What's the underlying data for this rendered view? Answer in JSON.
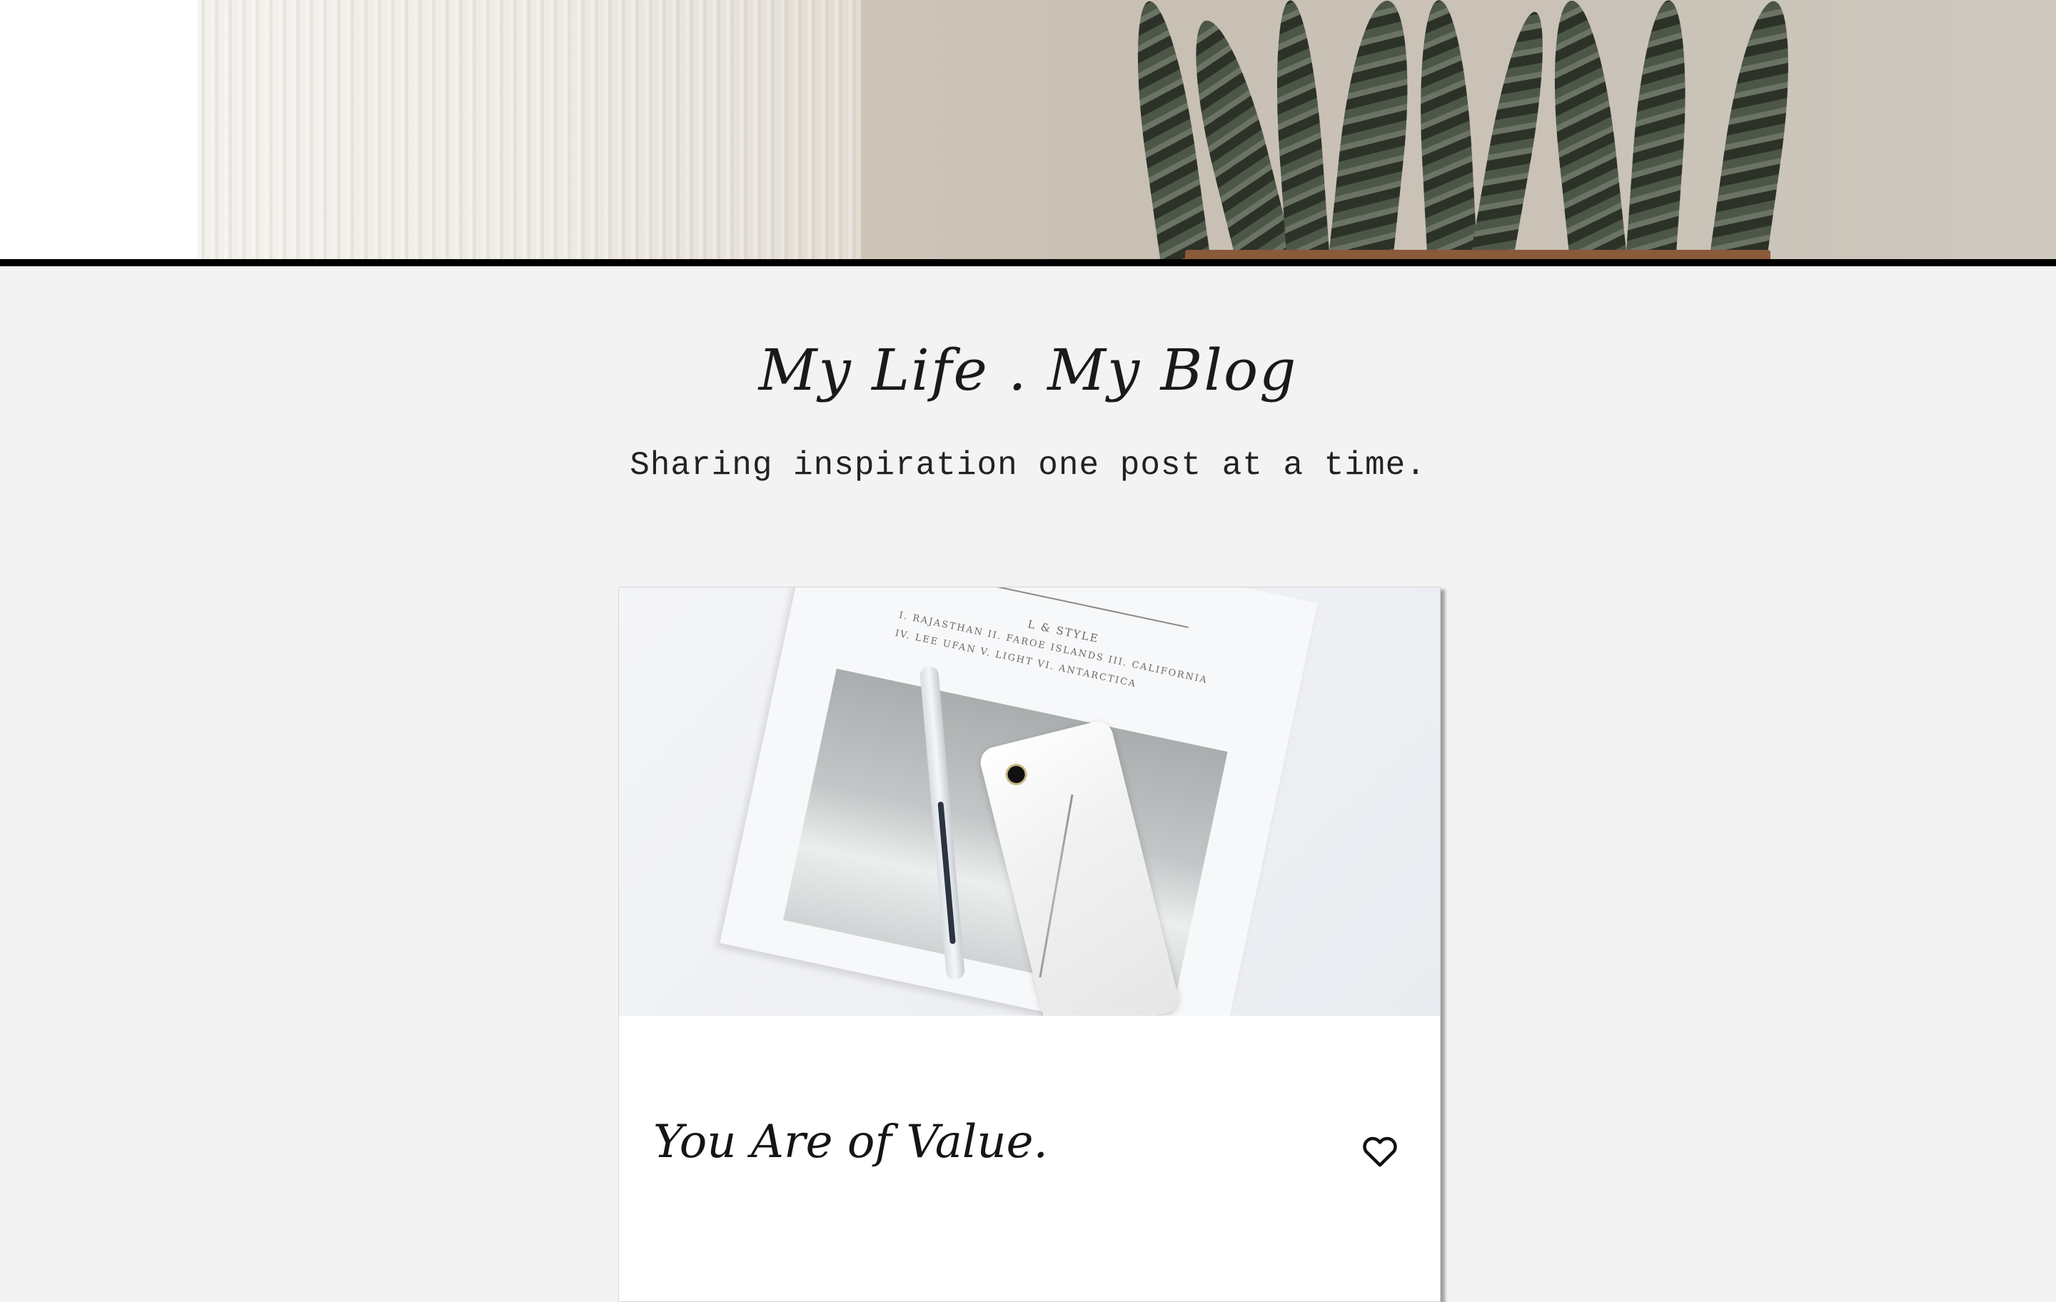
{
  "site": {
    "title": "My Life . My Blog",
    "tagline": "Sharing inspiration one post at a time."
  },
  "hero": {
    "image": "plant-and-curtain-photo"
  },
  "posts": [
    {
      "title": "You Are of Value.",
      "image": "magazine-phone-pen-photo",
      "image_text": [
        "L & STYLE",
        "I. RAJASTHAN   II. FAROE ISLANDS   III. CALIFORNIA",
        "IV. LEE UFAN   V. LIGHT   VI. ANTARCTICA"
      ],
      "like_icon": "heart-outline-icon"
    }
  ]
}
